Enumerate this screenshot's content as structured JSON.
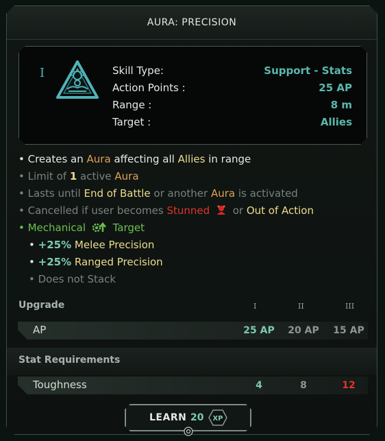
{
  "title": "AURA: PRECISION",
  "rank_mark": "I",
  "icons": {
    "skill": "aura-precision-icon",
    "stunned": "stunned-icon",
    "mechanical": "mechanical-icon",
    "xp": "xp-icon",
    "hint": "hint-icon"
  },
  "info": {
    "skill_type_label": "Skill Type:",
    "skill_type_value": "Support - Stats",
    "ap_label": "Action Points :",
    "ap_value": "25 AP",
    "range_label": "Range :",
    "range_value": "8 m",
    "target_label": "Target :",
    "target_value": "Allies"
  },
  "desc": {
    "l1": {
      "a": "• Creates an",
      "b": "Aura",
      "c": "affecting all",
      "d": "Allies",
      "e": "in range"
    },
    "l2": {
      "a": "• Limit of",
      "b": "1",
      "c": "active",
      "d": "Aura"
    },
    "l3": {
      "a": "• Lasts until",
      "b": "End of Battle",
      "c": "or another",
      "d": "Aura",
      "e": "is activated"
    },
    "l4": {
      "a": "• Cancelled if user becomes",
      "b": "Stunned",
      "c": "or",
      "d": "Out of Action"
    },
    "l5": {
      "a": "• Mechanical",
      "b": "Target"
    },
    "l6": {
      "a": "•",
      "b": "+25%",
      "c": "Melee Precision"
    },
    "l7": {
      "a": "•",
      "b": "+25%",
      "c": "Ranged Precision"
    },
    "l8": {
      "a": "• Does not Stack"
    }
  },
  "upgrade": {
    "title": "Upgrade",
    "ranks": [
      "I",
      "II",
      "III"
    ],
    "row_label": "AP",
    "values": [
      "25 AP",
      "20 AP",
      "15 AP"
    ]
  },
  "requirements": {
    "title": "Stat Requirements",
    "row_label": "Toughness",
    "values": [
      "4",
      "8",
      "12"
    ]
  },
  "learn": {
    "label": "LEARN",
    "cost": "20",
    "xp_label": "XP"
  },
  "colors": {
    "accent": "#5ab8ad",
    "highlight": "#ecdc8c",
    "aura": "#e0a153",
    "warning": "#e0342c",
    "mechanical": "#6dc04f"
  }
}
